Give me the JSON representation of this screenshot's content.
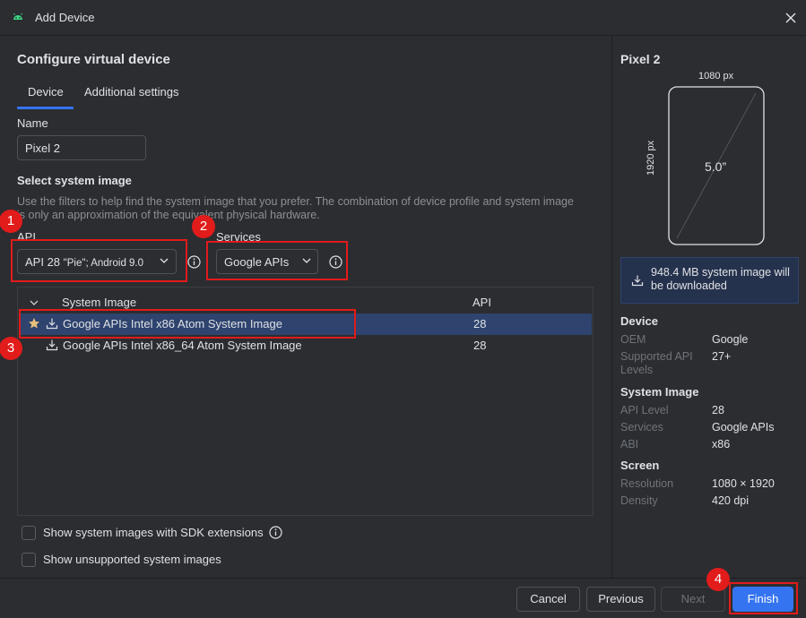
{
  "window": {
    "title": "Add Device"
  },
  "colors": {
    "accent": "#3574f0",
    "background": "#2b2d30",
    "selection": "#2e436e",
    "annotation": "#e21b1b",
    "star": "#e5c07b"
  },
  "main": {
    "heading": "Configure virtual device",
    "tabs": [
      {
        "label": "Device"
      },
      {
        "label": "Additional settings"
      }
    ],
    "name": {
      "label": "Name",
      "value": "Pixel 2"
    },
    "select_system_image": {
      "heading": "Select system image",
      "description": "Use the filters to help find the system image that you prefer. The combination of device profile and system image is only an approximation of the equivalent physical hardware.",
      "api_filter": {
        "label": "API",
        "value_main": "API 28",
        "value_detail": "\"Pie\"; Android 9.0"
      },
      "services_filter": {
        "label": "Services",
        "value": "Google APIs"
      }
    },
    "table": {
      "columns": [
        "System Image",
        "API"
      ],
      "rows": [
        {
          "name": "Google APIs Intel x86 Atom System Image",
          "api": "28",
          "selected": true,
          "starred": true
        },
        {
          "name": "Google APIs Intel x86_64 Atom System Image",
          "api": "28",
          "selected": false,
          "starred": false
        }
      ]
    },
    "checkboxes": [
      {
        "label": "Show system images with SDK extensions",
        "checked": false
      },
      {
        "label": "Show unsupported system images",
        "checked": false
      }
    ]
  },
  "panel": {
    "device_name": "Pixel 2",
    "preview": {
      "width": "1080 px",
      "height": "1920 px",
      "size": "5.0”"
    },
    "download_notice": "948.4 MB system image will be downloaded",
    "device": {
      "heading": "Device",
      "oem_key": "OEM",
      "oem": "Google",
      "levels_key": "Supported API Levels",
      "levels": "27+"
    },
    "system_image": {
      "heading": "System Image",
      "api_key": "API Level",
      "api": "28",
      "services_key": "Services",
      "services": "Google APIs",
      "abi_key": "ABI",
      "abi": "x86"
    },
    "screen": {
      "heading": "Screen",
      "resolution_key": "Resolution",
      "resolution": "1080 × 1920",
      "density_key": "Density",
      "density": "420 dpi"
    }
  },
  "footer": {
    "cancel": "Cancel",
    "previous": "Previous",
    "next": "Next",
    "finish": "Finish"
  },
  "annotations": [
    "1",
    "2",
    "3",
    "4"
  ]
}
